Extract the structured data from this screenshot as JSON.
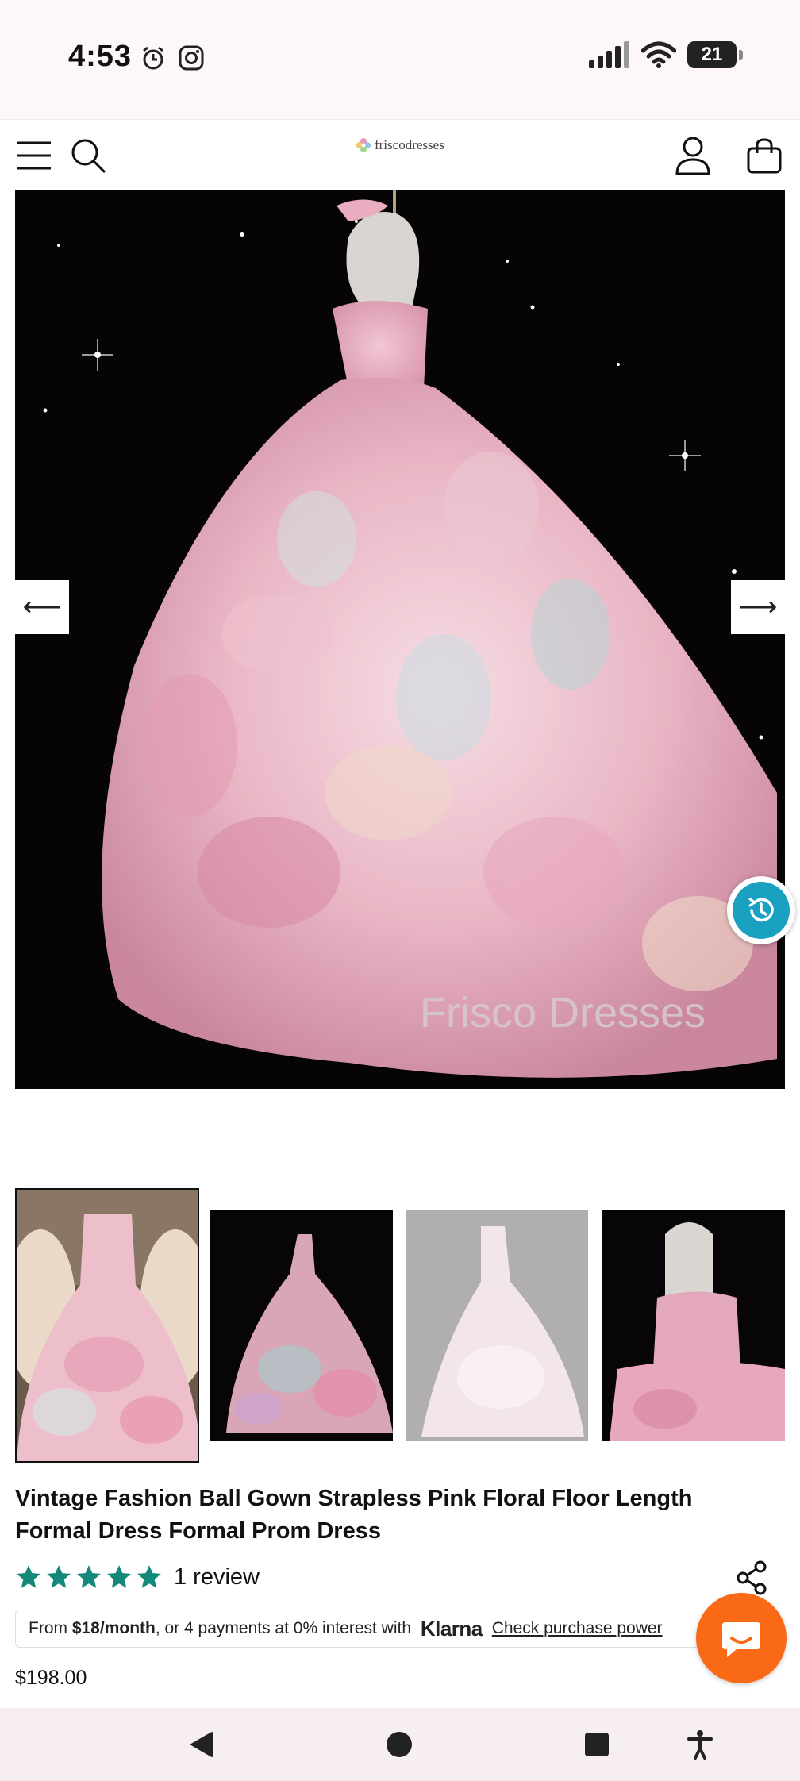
{
  "status_bar": {
    "time": "4:53",
    "battery": "21",
    "icons": [
      "alarm-icon",
      "instagram-icon",
      "signal-icon",
      "wifi-icon",
      "battery-icon"
    ]
  },
  "header": {
    "logo_text": "friscodresses",
    "icons": [
      "menu-icon",
      "search-icon",
      "account-icon",
      "cart-icon"
    ]
  },
  "hero": {
    "watermark": "Frisco Dresses",
    "prev_arrow": "⟵",
    "next_arrow": "⟶"
  },
  "product": {
    "title": "Vintage Fashion Ball Gown Strapless Pink Floral Floor Length Formal Dress Formal Prom Dress",
    "stars": 5,
    "review_count_text": "1 review",
    "klarna": {
      "prefix": "From ",
      "amount": "$18/month",
      "middle": ", or 4 payments at 0% interest with ",
      "brand": "Klarna",
      "link": "Check purchase power"
    },
    "price": "$198.00"
  },
  "colors": {
    "accent_star": "#14897a",
    "chat_button": "#fa6a16",
    "history_button": "#1aa1c1"
  }
}
